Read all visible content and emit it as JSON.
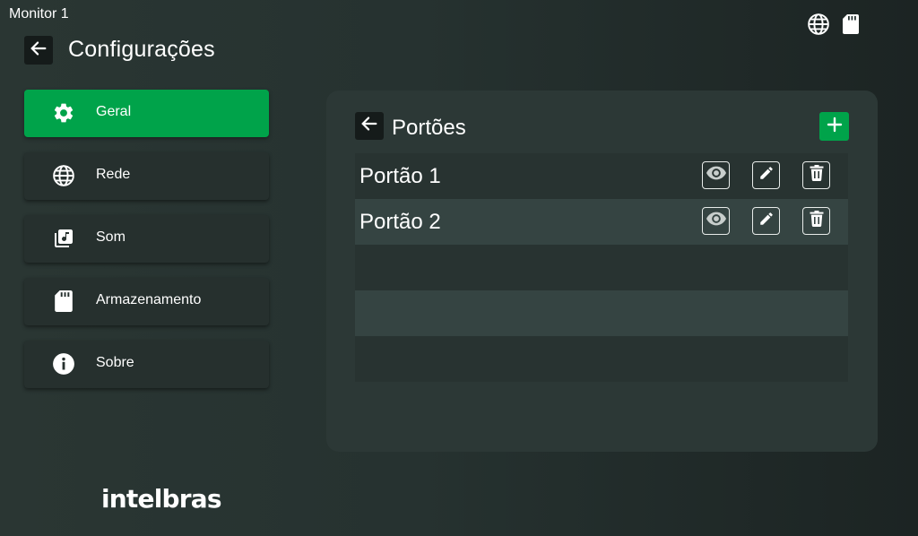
{
  "window": {
    "title": "Monitor 1"
  },
  "status_icons": [
    {
      "icon": "globe-icon"
    },
    {
      "icon": "sd-card-icon"
    }
  ],
  "header": {
    "back_icon": "arrow-left-icon",
    "title": "Configurações"
  },
  "sidebar": {
    "items": [
      {
        "label": "Geral",
        "icon": "gear-icon",
        "active": true
      },
      {
        "label": "Rede",
        "icon": "globe-icon",
        "active": false
      },
      {
        "label": "Som",
        "icon": "music-library-icon",
        "active": false
      },
      {
        "label": "Armazenamento",
        "icon": "sd-card-icon",
        "active": false
      },
      {
        "label": "Sobre",
        "icon": "info-icon",
        "active": false
      }
    ]
  },
  "panel": {
    "back_icon": "arrow-left-icon",
    "title": "Portões",
    "add_icon": "plus-icon",
    "gates": [
      {
        "name": "Portão 1"
      },
      {
        "name": "Portão 2"
      }
    ],
    "empty_rows": 3,
    "row_actions": [
      "eye-icon",
      "pencil-icon",
      "trash-icon"
    ]
  },
  "brand": {
    "logo_text": "intelbras"
  },
  "colors": {
    "accent": "#00a34a",
    "background": "#263230",
    "panel": "#2c3836",
    "row_dark": "#283331",
    "row_light": "#354442"
  }
}
